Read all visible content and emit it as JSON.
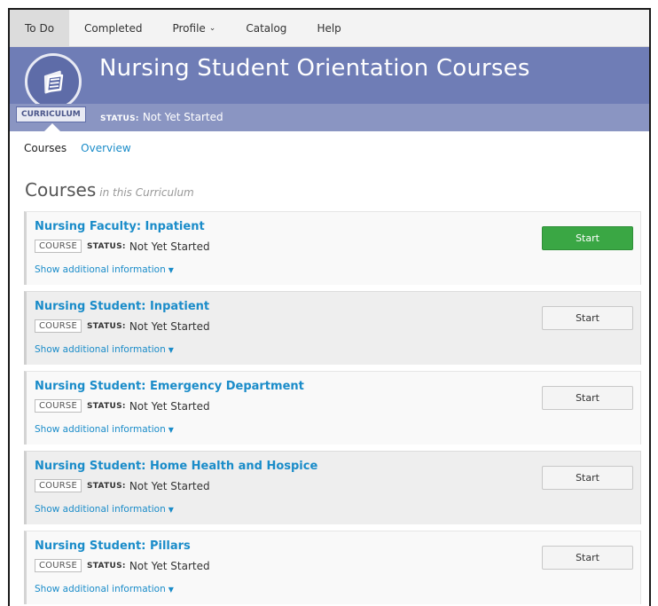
{
  "nav": {
    "items": [
      {
        "label": "To Do",
        "active": true
      },
      {
        "label": "Completed",
        "active": false
      },
      {
        "label": "Profile",
        "active": false,
        "dropdown": true
      },
      {
        "label": "Catalog",
        "active": false
      },
      {
        "label": "Help",
        "active": false
      }
    ],
    "caret": "⌄"
  },
  "banner": {
    "title": "Nursing Student Orientation Courses",
    "type_tag": "CURRICULUM",
    "status_label": "STATUS:",
    "status_value": "Not Yet Started",
    "icon": "curriculum-stack-icon"
  },
  "subtabs": {
    "current": "Courses",
    "overview": "Overview"
  },
  "section": {
    "heading": "Courses",
    "subheading": "in this Curriculum"
  },
  "courses": [
    {
      "title": "Nursing Faculty: Inpatient",
      "tag": "COURSE",
      "status_label": "STATUS:",
      "status": "Not Yet Started",
      "more": "Show additional information",
      "button": "Start",
      "primary": true
    },
    {
      "title": "Nursing Student: Inpatient",
      "tag": "COURSE",
      "status_label": "STATUS:",
      "status": "Not Yet Started",
      "more": "Show additional information",
      "button": "Start",
      "primary": false
    },
    {
      "title": "Nursing Student: Emergency Department",
      "tag": "COURSE",
      "status_label": "STATUS:",
      "status": "Not Yet Started",
      "more": "Show additional information",
      "button": "Start",
      "primary": false
    },
    {
      "title": "Nursing Student: Home Health and Hospice",
      "tag": "COURSE",
      "status_label": "STATUS:",
      "status": "Not Yet Started",
      "more": "Show additional information",
      "button": "Start",
      "primary": false
    },
    {
      "title": "Nursing Student: Pillars",
      "tag": "COURSE",
      "status_label": "STATUS:",
      "status": "Not Yet Started",
      "more": "Show additional information",
      "button": "Start",
      "primary": false
    }
  ],
  "colors": {
    "banner": "#6f7db6",
    "link": "#1a8cc9",
    "primary_button": "#3aa744"
  }
}
